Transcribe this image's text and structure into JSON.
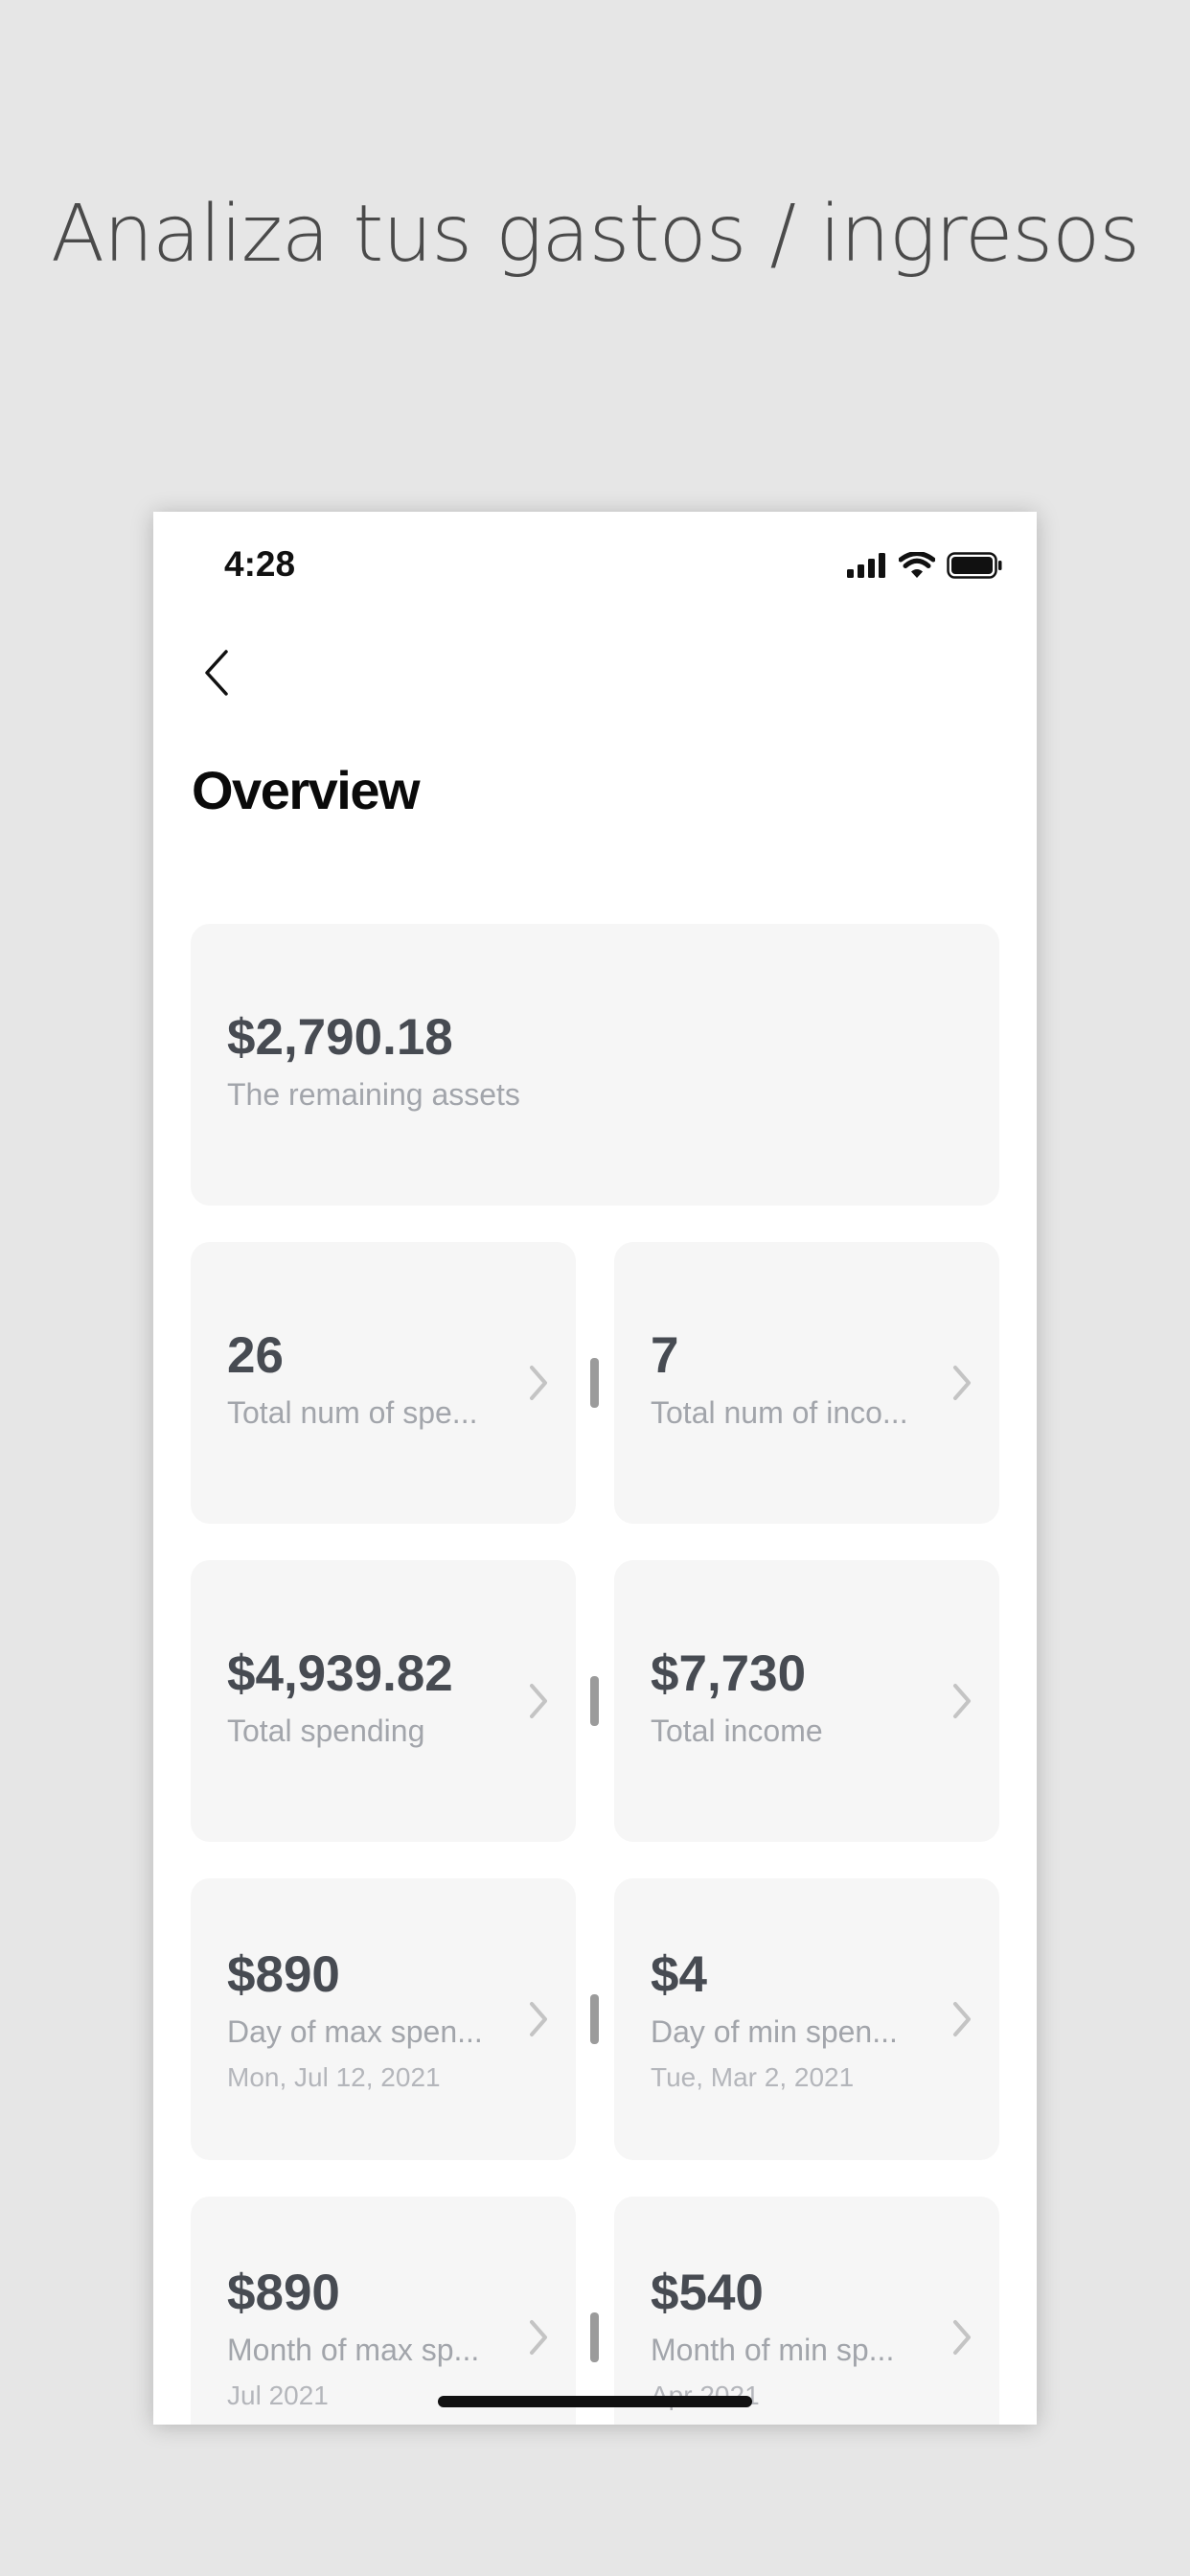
{
  "headline": "Analiza tus gastos / ingresos",
  "status_bar": {
    "time": "4:28",
    "icons": [
      "cellular-signal-icon",
      "wifi-icon",
      "battery-icon"
    ]
  },
  "nav": {
    "back_icon": "chevron-left-icon"
  },
  "page_title": "Overview",
  "summary_card": {
    "value": "$2,790.18",
    "label": "The remaining assets"
  },
  "cards": [
    {
      "value": "26",
      "label": "Total num of spe...",
      "date": ""
    },
    {
      "value": "7",
      "label": "Total num of inco...",
      "date": ""
    },
    {
      "value": "$4,939.82",
      "label": "Total spending",
      "date": ""
    },
    {
      "value": "$7,730",
      "label": "Total income",
      "date": ""
    },
    {
      "value": "$890",
      "label": "Day of max spen...",
      "date": "Mon, Jul 12, 2021"
    },
    {
      "value": "$4",
      "label": "Day of min spen...",
      "date": "Tue, Mar 2, 2021"
    },
    {
      "value": "$890",
      "label": "Month of max sp...",
      "date": "Jul 2021"
    },
    {
      "value": "$540",
      "label": "Month of min sp...",
      "date": "Apr 2021"
    }
  ],
  "colors": {
    "background": "#e6e6e6",
    "card_background": "#f6f6f6",
    "value_text": "#474b52",
    "label_text": "#a2a5ab"
  }
}
